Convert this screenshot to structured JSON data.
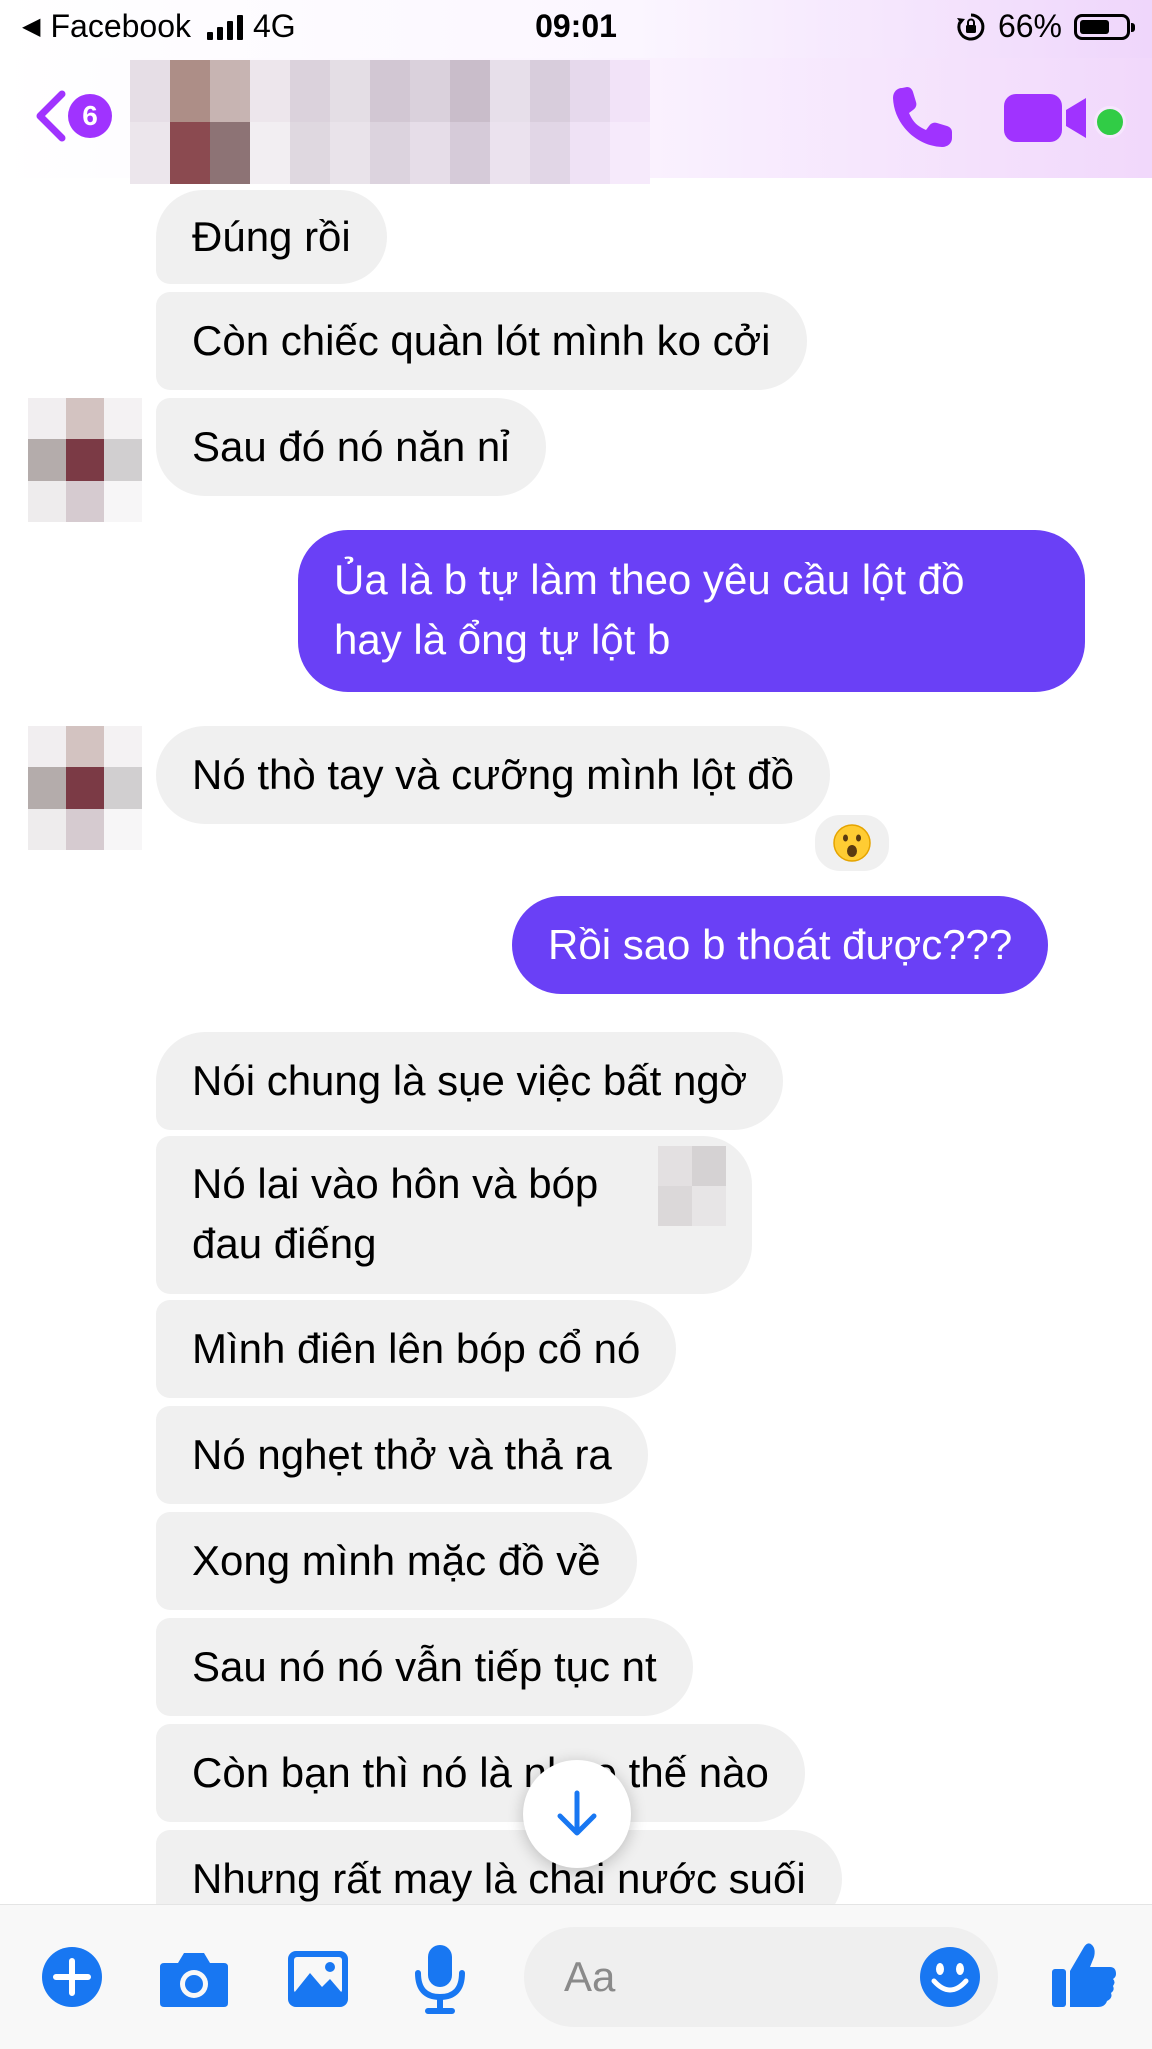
{
  "status_bar": {
    "back_app": "Facebook",
    "network": "4G",
    "time": "09:01",
    "battery_percent_text": "66%",
    "battery_level": 0.66
  },
  "header": {
    "unread_count": "6",
    "icons": {
      "back": "chevron-left-icon",
      "call": "phone-icon",
      "video": "video-camera-icon"
    },
    "accent_color": "#a033ff",
    "online_color": "#31cc46"
  },
  "messages": [
    {
      "from": "contact",
      "text": "Đúng rồi"
    },
    {
      "from": "contact",
      "text": "Còn chiếc quàn lót mình ko cởi"
    },
    {
      "from": "contact",
      "text": "Sau đó nó năn nỉ"
    },
    {
      "from": "me",
      "lines": [
        "Ủa là b tự làm theo yêu cầu lột đồ",
        "hay là ổng tự lột b"
      ]
    },
    {
      "from": "contact",
      "text": "Nó thò tay và cưỡng mình lột đồ",
      "reaction": "😮"
    },
    {
      "from": "me",
      "text": "Rồi sao b thoát được???"
    },
    {
      "from": "contact",
      "text": "Nói chung là sụe việc bất ngờ"
    },
    {
      "from": "contact",
      "lines": [
        "Nó lai vào hôn và bóp",
        "đau điếng"
      ]
    },
    {
      "from": "contact",
      "text": "Mình điên lên bóp cổ nó"
    },
    {
      "from": "contact",
      "text": "Nó nghẹt thở và thả ra"
    },
    {
      "from": "contact",
      "text": "Xong mình mặc đồ về"
    },
    {
      "from": "contact",
      "text": "Sau nó nó vẫn tiếp tục nt"
    },
    {
      "from": "contact",
      "text": "Còn bạn thì nó là    nhue thế nào"
    },
    {
      "from": "contact",
      "text": "Nhưng rất may là chai nước suối"
    }
  ],
  "composer": {
    "placeholder": "Aa",
    "icons": [
      "plus-icon",
      "camera-icon",
      "image-icon",
      "microphone-icon",
      "emoji-icon",
      "thumbs-up-icon"
    ],
    "icon_color": "#1877f2"
  },
  "colors": {
    "incoming_bubble": "#f0f0f0",
    "outgoing_bubble": "#6a40f6"
  }
}
